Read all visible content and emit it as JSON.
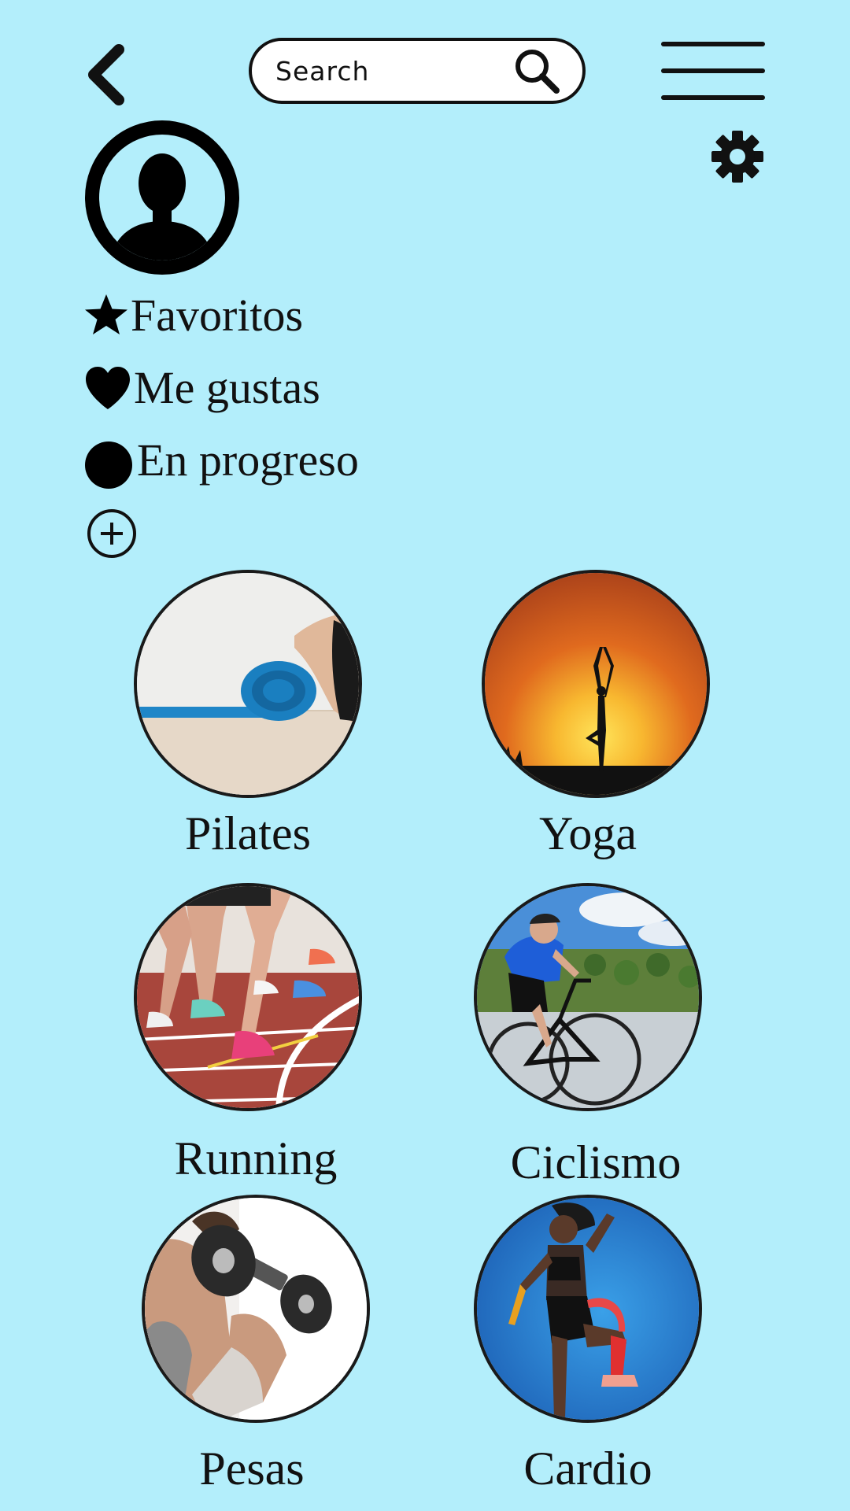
{
  "header": {
    "search": {
      "placeholder": "Search",
      "value": ""
    },
    "back_icon": "chevron-left-icon",
    "search_icon": "magnifier-icon",
    "menu_icon": "hamburger-menu-icon",
    "settings_icon": "gear-icon"
  },
  "profile": {
    "avatar_icon": "user-silhouette-icon"
  },
  "shortcuts": [
    {
      "label": "Favoritos",
      "icon": "star-icon"
    },
    {
      "label": "Me gustas",
      "icon": "heart-icon"
    },
    {
      "label": "En progreso",
      "icon": "filled-circle-icon"
    }
  ],
  "add_icon": "plus-circle-icon",
  "categories": [
    {
      "label": "Pilates"
    },
    {
      "label": "Yoga"
    },
    {
      "label": "Running"
    },
    {
      "label": "Ciclismo"
    },
    {
      "label": "Pesas"
    },
    {
      "label": "Cardio"
    }
  ],
  "colors": {
    "background": "#b3eefb",
    "foreground": "#111111"
  }
}
